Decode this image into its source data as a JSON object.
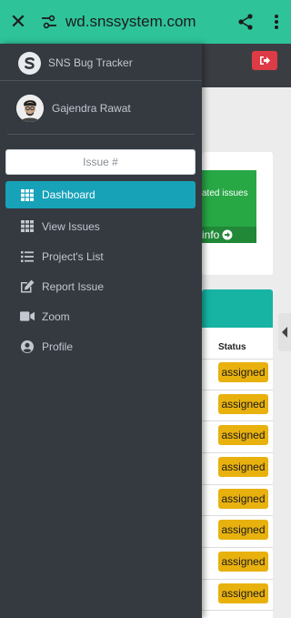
{
  "browser": {
    "url": "wd.snssystem.com"
  },
  "sidebar": {
    "brand": "SNS Bug Tracker",
    "user_name": "Gajendra Rawat",
    "search_placeholder": "Issue #",
    "items": [
      {
        "label": "Dashboard",
        "icon": "grid-icon",
        "active": true
      },
      {
        "label": "View Issues",
        "icon": "grid-icon",
        "active": false
      },
      {
        "label": "Project's List",
        "icon": "list-icon",
        "active": false
      },
      {
        "label": "Report Issue",
        "icon": "edit-icon",
        "active": false
      },
      {
        "label": "Zoom",
        "icon": "video-icon",
        "active": false
      },
      {
        "label": "Profile",
        "icon": "user-circle-icon",
        "active": false
      }
    ]
  },
  "dashboard": {
    "stat_card_text": "ated issues",
    "stat_card_link": "info",
    "table_status_header": "Status",
    "status_badges": [
      "assigned",
      "assigned",
      "assigned",
      "assigned",
      "assigned",
      "assigned",
      "assigned",
      "assigned"
    ]
  },
  "colors": {
    "browser_bar": "#2fc39a",
    "sidebar": "#343a40",
    "active_item": "#17a2b8",
    "logout": "#dd3b45",
    "badge": "#e8b10e",
    "stat_card": "#28a745"
  }
}
